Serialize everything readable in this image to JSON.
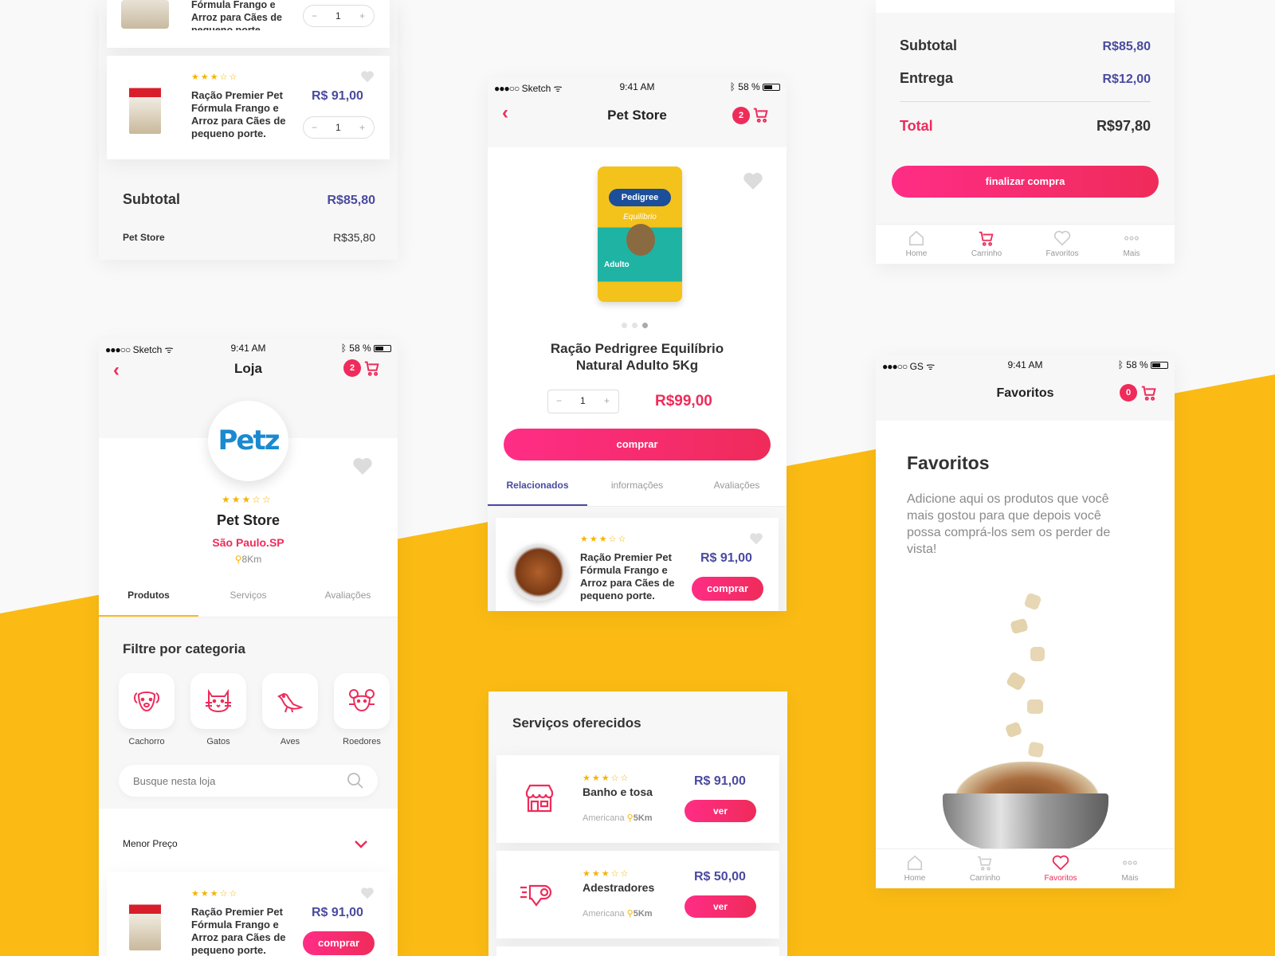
{
  "colors": {
    "accent": "#ef2b5a",
    "accent2": "#ff2d86",
    "indigo": "#4a4aa0",
    "yellow": "#fbbb14",
    "star": "#f5b400"
  },
  "status": {
    "carrier": "Sketch",
    "carrier_gs": "GS",
    "time": "9:41 AM",
    "battery": "58 %"
  },
  "card1": {
    "item0": {
      "name_tail": "Fórmula Frango e Arroz para Cães de pequeno porte.",
      "qty": "1"
    },
    "item1": {
      "rating": 3,
      "name": "Ração Premier Pet Fórmula Frango e Arroz para Cães de pequeno porte.",
      "price": "R$ 91,00",
      "qty": "1"
    },
    "subtotal_label": "Subtotal",
    "subtotal": "R$85,80",
    "store_label": "Pet Store",
    "store_value": "R$35,80"
  },
  "loja": {
    "title": "Loja",
    "cart_count": "2",
    "logo": "Petz",
    "rating": 3,
    "store_name": "Pet Store",
    "city": "São Paulo.SP",
    "distance": "8Km",
    "tabs": [
      "Produtos",
      "Serviços",
      "Avaliações"
    ],
    "filter_title": "Filtre por categoria",
    "categories": [
      "Cachorro",
      "Gatos",
      "Aves",
      "Roedores"
    ],
    "search_placeholder": "Busque nesta loja",
    "sort": "Menor Preço",
    "item": {
      "rating": 3,
      "name": "Ração Premier Pet Fórmula Frango e Arroz para Cães de pequeno porte.",
      "price": "R$ 91,00",
      "buy": "comprar"
    }
  },
  "product": {
    "title": "Pet Store",
    "cart_count": "2",
    "name": "Ração Pedrigree Equilíbrio Natural Adulto 5Kg",
    "qty": "1",
    "price": "R$99,00",
    "buy": "comprar",
    "pack_brand": "Pedigree",
    "pack_line": "Equilíbrio",
    "pack_variant": "Adulto",
    "tabs": [
      "Relacionados",
      "informações",
      "Avaliações"
    ],
    "related": {
      "rating": 3,
      "name": "Ração Premier Pet Fórmula Frango e Arroz para Cães de pequeno porte.",
      "price": "R$ 91,00",
      "buy": "comprar"
    }
  },
  "services": {
    "title": "Serviços oferecidos",
    "items": [
      {
        "rating": 3,
        "name": "Banho e tosa",
        "city": "Americana",
        "distance": "5Km",
        "price": "R$ 91,00",
        "btn": "ver"
      },
      {
        "rating": 3,
        "name": "Adestradores",
        "city": "Americana",
        "distance": "5Km",
        "price": "R$ 50,00",
        "btn": "ver"
      }
    ]
  },
  "checkout": {
    "subtotal_label": "Subtotal",
    "subtotal": "R$85,80",
    "delivery_label": "Entrega",
    "delivery": "R$12,00",
    "total_label": "Total",
    "total": "R$97,80",
    "cta": "finalizar compra"
  },
  "bottom_nav": [
    "Home",
    "Carrinho",
    "Favoritos",
    "Mais"
  ],
  "favoritos": {
    "title": "Favoritos",
    "cart_count": "0",
    "heading": "Favoritos",
    "text": "Adicione aqui os produtos que você mais gostou para que depois você possa comprá-los sem os perder de vista!"
  }
}
